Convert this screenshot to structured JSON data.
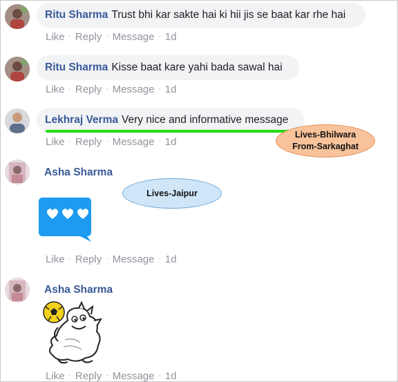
{
  "comments": [
    {
      "author": "Ritu Sharma",
      "text": "Trust bhi kar sakte hai ki hii jis se baat kar rhe hai",
      "actions": {
        "like": "Like",
        "reply": "Reply",
        "message": "Message",
        "time": "1d"
      }
    },
    {
      "author": "Ritu Sharma",
      "text": "Kisse baat kare yahi bada sawal hai",
      "actions": {
        "like": "Like",
        "reply": "Reply",
        "message": "Message",
        "time": "1d"
      }
    },
    {
      "author": "Lekhraj Verma",
      "text": "Very nice and informative message",
      "actions": {
        "like": "Like",
        "reply": "Reply",
        "message": "Message",
        "time": "1d"
      }
    },
    {
      "author": "Asha Sharma",
      "sticker": "three-hearts-chat-bubble",
      "actions": {
        "like": "Like",
        "reply": "Reply",
        "message": "Message",
        "time": "1d"
      }
    },
    {
      "author": "Asha Sharma",
      "sticker": "dinosaur-kicking-football",
      "actions": {
        "like": "Like",
        "reply": "Reply",
        "message": "Message",
        "time": "1d"
      }
    }
  ],
  "annotations": {
    "callout_bhilwara_line1": "Lives-Bhilwara",
    "callout_bhilwara_line2": "From-Sarkaghat",
    "callout_jaipur": "Lives-Jaipur"
  },
  "colors": {
    "author_link": "#385898",
    "bubble_bg": "#f2f3f5",
    "meta_text": "#90949c",
    "highlight_line": "#22dd11",
    "callout_orange": "#f8c29a",
    "callout_blue": "#cfe6f8",
    "heart_sticker": "#1e9bf0"
  }
}
